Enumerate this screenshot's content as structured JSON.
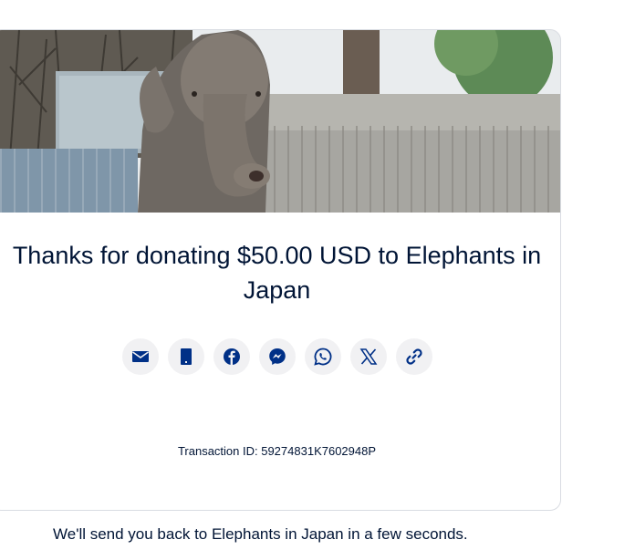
{
  "hero": {
    "image": "elephant-photo"
  },
  "thanks": {
    "title": "Thanks for donating $50.00 USD to Elephants in Japan"
  },
  "share": {
    "buttons": [
      {
        "icon": "email-icon",
        "label": "Email"
      },
      {
        "icon": "sms-icon",
        "label": "Text message"
      },
      {
        "icon": "facebook-icon",
        "label": "Facebook"
      },
      {
        "icon": "messenger-icon",
        "label": "Messenger"
      },
      {
        "icon": "whatsapp-icon",
        "label": "WhatsApp"
      },
      {
        "icon": "x-icon",
        "label": "X"
      },
      {
        "icon": "link-icon",
        "label": "Copy link"
      }
    ],
    "icon_color": "#003087",
    "button_bg": "#f1f1f3"
  },
  "transaction": {
    "text": "Transaction ID: 59274831K7602948P"
  },
  "redirect": {
    "text": "We'll send you back to Elephants in Japan in a few seconds."
  }
}
